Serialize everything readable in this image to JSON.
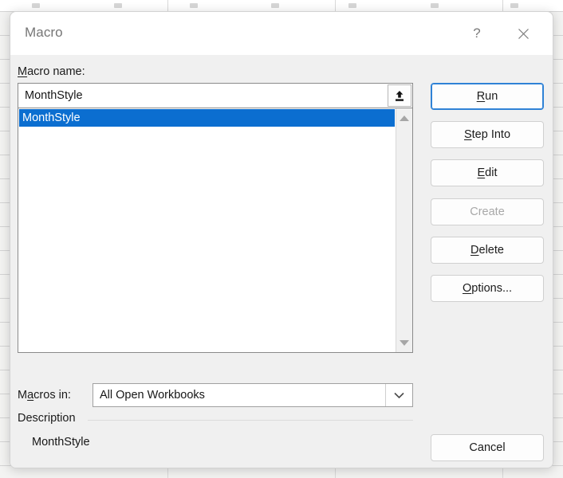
{
  "backdrop": {
    "app": "excel-spreadsheet-grid"
  },
  "dialog": {
    "title": "Macro",
    "help_icon": "question-mark-icon",
    "close_icon": "close-x-icon",
    "accent_color": "#2f82d6",
    "selection_color": "#0b6ed0"
  },
  "macro_name": {
    "label": "Macro name:",
    "label_accesskey": "M",
    "value": "MonthStyle",
    "placeholder": "",
    "upload_icon": "upload-arrow-icon"
  },
  "macro_list": {
    "items": [
      {
        "label": "MonthStyle",
        "selected": true
      }
    ],
    "scrollbar": {
      "up_icon": "triangle-up-icon",
      "down_icon": "triangle-down-icon"
    }
  },
  "macros_in": {
    "label": "Macros in:",
    "label_accesskey": "a",
    "selected": "All Open Workbooks",
    "dropdown_icon": "chevron-down-icon"
  },
  "description": {
    "label": "Description",
    "text": "MonthStyle"
  },
  "buttons": {
    "run": {
      "label": "Run",
      "accesskey": "R",
      "state": "default-focused"
    },
    "step_into": {
      "label": "Step Into",
      "accesskey": "S",
      "state": "enabled"
    },
    "edit": {
      "label": "Edit",
      "accesskey": "E",
      "state": "enabled"
    },
    "create": {
      "label": "Create",
      "accesskey": "C",
      "state": "disabled"
    },
    "delete": {
      "label": "Delete",
      "accesskey": "D",
      "state": "enabled"
    },
    "options": {
      "label": "Options...",
      "accesskey": "O",
      "state": "enabled"
    },
    "cancel": {
      "label": "Cancel",
      "accesskey": "",
      "state": "enabled"
    }
  }
}
